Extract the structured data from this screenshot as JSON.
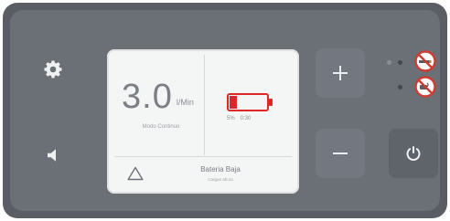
{
  "colors": {
    "housing": "#5a5d64",
    "panel": "#6b6f76",
    "screen": "#f4f5f5",
    "battery_low": "#e02727",
    "no_sign_red": "#d03a2f"
  },
  "display": {
    "flow_value": "3.0",
    "flow_unit": "l/Min",
    "mode_label": "Modo Continuo",
    "battery": {
      "level_fraction": 0.2,
      "percent_text": "5%",
      "time_text": "0:30"
    },
    "alert": {
      "title": "Bateria Baja",
      "subtitle": "Cargue ahora"
    }
  },
  "icons": {
    "settings": "gear-icon",
    "volume": "speaker-icon",
    "increase": "plus-icon",
    "decrease": "minus-icon",
    "power": "power-icon",
    "alert": "warning-triangle-icon",
    "indicator_1": "no-smoking-icon",
    "indicator_2": "no-smoking-icon"
  }
}
